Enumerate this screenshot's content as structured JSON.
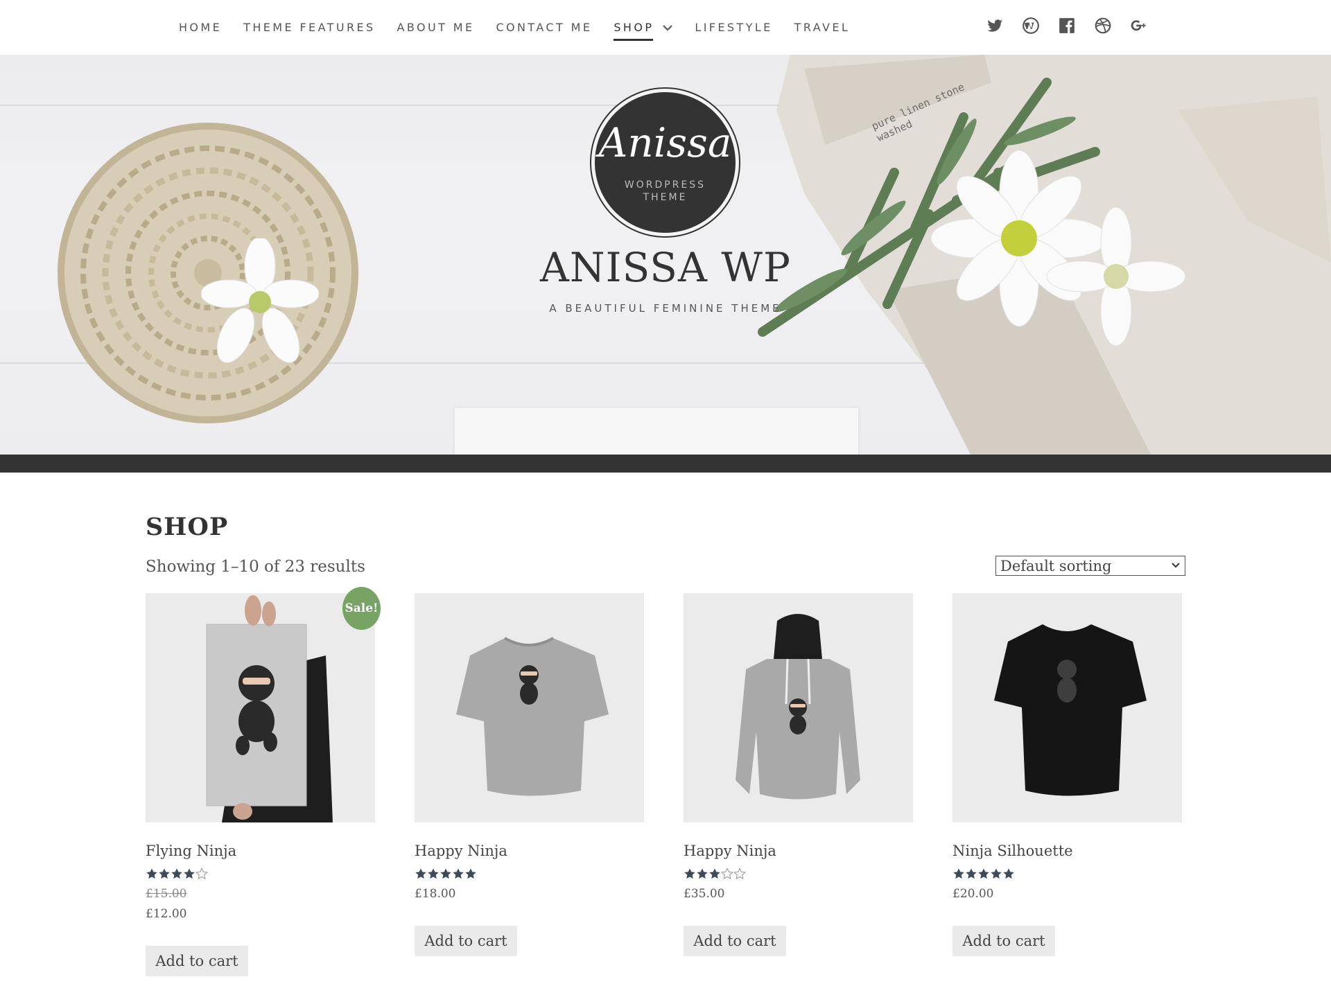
{
  "nav": {
    "items": [
      {
        "label": "HOME"
      },
      {
        "label": "THEME FEATURES"
      },
      {
        "label": "ABOUT ME"
      },
      {
        "label": "CONTACT ME"
      },
      {
        "label": "SHOP",
        "active": true,
        "has_dropdown": true
      },
      {
        "label": "LIFESTYLE"
      },
      {
        "label": "TRAVEL"
      }
    ],
    "social_icons": [
      "twitter-icon",
      "wordpress-icon",
      "facebook-icon",
      "dribbble-icon",
      "google-plus-icon"
    ]
  },
  "hero": {
    "logo_script": "Anissa",
    "logo_sub_line1": "WORDPRESS",
    "logo_sub_line2": "THEME",
    "site_title": "ANISSA WP",
    "tagline": "A BEAUTIFUL FEMININE THEME",
    "linen_stamp": "pure linen stone washed"
  },
  "shop": {
    "title": "SHOP",
    "result_count": "Showing 1–10 of 23 results",
    "sort_selected": "Default sorting",
    "products": [
      {
        "name": "Flying Ninja",
        "rating": 4,
        "price_old": "£15.00",
        "price": "£12.00",
        "sale_label": "Sale!",
        "button": "Add to cart"
      },
      {
        "name": "Happy Ninja",
        "rating": 5,
        "price": "£18.00",
        "button": "Add to cart"
      },
      {
        "name": "Happy Ninja",
        "rating": 3,
        "price": "£35.00",
        "button": "Add to cart"
      },
      {
        "name": "Ninja Silhouette",
        "rating": 5,
        "price": "£20.00",
        "button": "Add to cart"
      }
    ]
  },
  "colors": {
    "accent_dark": "#333333",
    "sale_green": "#77a464",
    "star": "#3f4a59"
  }
}
